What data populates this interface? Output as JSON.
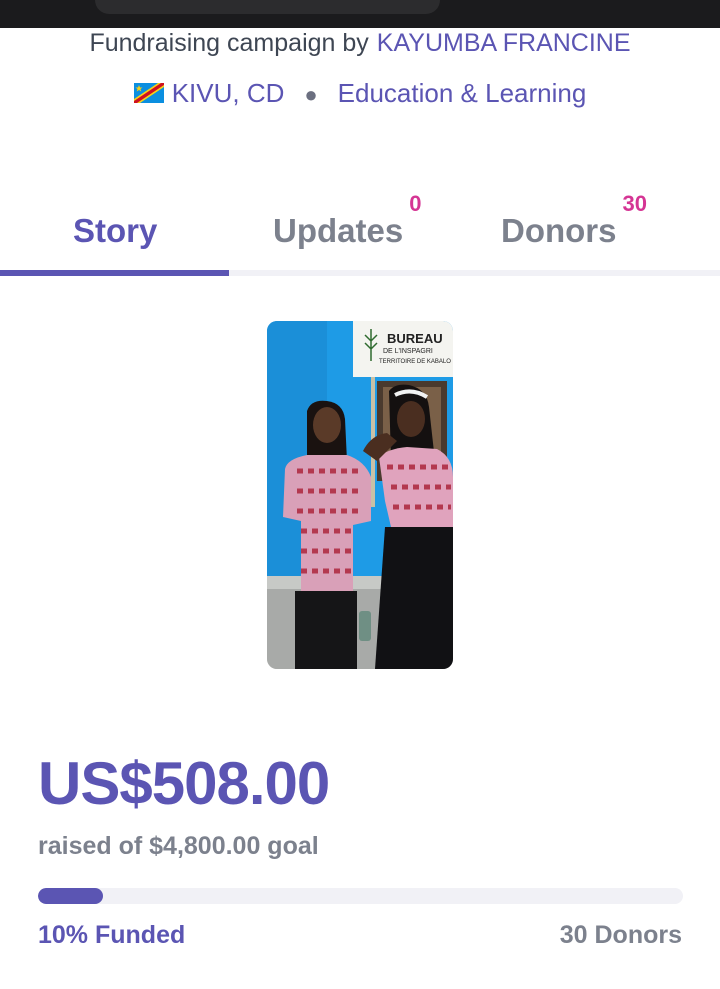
{
  "campaign": {
    "byline_prefix": "Fundraising campaign by",
    "owner_name": "KAYUMBA FRANCINE",
    "location": "KIVU, CD",
    "location_flag": "drc-flag-icon",
    "category": "Education & Learning"
  },
  "tabs": [
    {
      "label": "Story",
      "badge": "",
      "active": true
    },
    {
      "label": "Updates",
      "badge": "0",
      "active": false
    },
    {
      "label": "Donors",
      "badge": "30",
      "active": false
    }
  ],
  "photo": {
    "sign_line1": "BUREAU",
    "sign_line2": "DE L'INSPAGRI",
    "sign_line3": "TERRITOIRE DE KABALO"
  },
  "funding": {
    "amount_raised": "US$508.00",
    "goal_text": "raised of $4,800.00 goal",
    "progress_fraction": 0.1,
    "funded_label": "10% Funded",
    "donors_label": "30 Donors"
  },
  "colors": {
    "accent": "#5b55b3",
    "badge": "#d53594",
    "muted_text": "#7c818d",
    "track": "#f1f1f6"
  }
}
